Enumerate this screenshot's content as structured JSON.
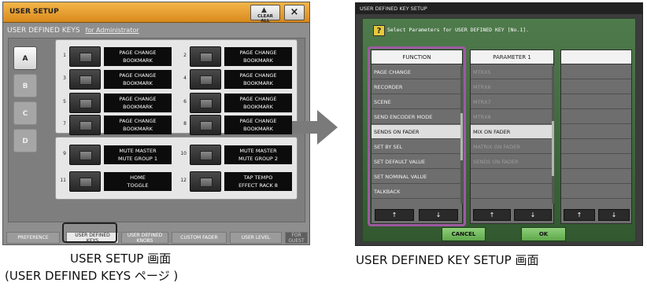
{
  "left_panel": {
    "title": "USER SETUP",
    "clear_all_label": "CLEAR ALL",
    "close_label": "×",
    "subtitle": "USER DEFINED KEYS",
    "subtitle_link": "for Administrator",
    "letter_tabs": [
      "A",
      "B",
      "C",
      "D"
    ],
    "keys": [
      {
        "num": "1",
        "line1": "PAGE CHANGE",
        "line2": "BOOKMARK"
      },
      {
        "num": "2",
        "line1": "PAGE CHANGE",
        "line2": "BOOKMARK"
      },
      {
        "num": "3",
        "line1": "PAGE CHANGE",
        "line2": "BOOKMARK"
      },
      {
        "num": "4",
        "line1": "PAGE CHANGE",
        "line2": "BOOKMARK"
      },
      {
        "num": "5",
        "line1": "PAGE CHANGE",
        "line2": "BOOKMARK"
      },
      {
        "num": "6",
        "line1": "PAGE CHANGE",
        "line2": "BOOKMARK"
      },
      {
        "num": "7",
        "line1": "PAGE CHANGE",
        "line2": "BOOKMARK"
      },
      {
        "num": "8",
        "line1": "PAGE CHANGE",
        "line2": "BOOKMARK"
      },
      {
        "num": "9",
        "line1": "MUTE MASTER",
        "line2": "MUTE GROUP 1"
      },
      {
        "num": "10",
        "line1": "MUTE MASTER",
        "line2": "MUTE GROUP 2"
      },
      {
        "num": "11",
        "line1": "HOME",
        "line2": "TOGGLE"
      },
      {
        "num": "12",
        "line1": "TAP TEMPO",
        "line2": "EFFECT RACK 8"
      }
    ],
    "bottom_tabs": [
      {
        "line1": "PREFERENCE",
        "line2": ""
      },
      {
        "line1": "USER DEFINED",
        "line2": "KEYS"
      },
      {
        "line1": "USER DEFINED",
        "line2": "KNOBS"
      },
      {
        "line1": "CUSTOM FADER",
        "line2": ""
      },
      {
        "line1": "USER LEVEL",
        "line2": ""
      },
      {
        "line1": "FOR",
        "line2": "GUEST"
      }
    ],
    "caption_line1": "USER SETUP 画面",
    "caption_line2": "(USER DEFINED KEYS ページ )"
  },
  "right_panel": {
    "title": "USER DEFINED KEY SETUP",
    "help_icon": "?",
    "subtitle": "Select Parameters for USER DEFINED KEY [No.1].",
    "function_header": "FUNCTION",
    "function_items": [
      "PAGE CHANGE",
      "RECORDER",
      "SCENE",
      "SEND ENCODER MODE",
      "SENDS ON FADER",
      "SET BY SEL",
      "SET DEFAULT VALUE",
      "SET NOMINAL VALUE",
      "TALKBACK"
    ],
    "param1_header": "PARAMETER 1",
    "param1_items": [
      "MTRX5",
      "MTRX6",
      "MTRX7",
      "MTRX8",
      "MIX ON FADER",
      "MATRIX ON FADER",
      "SENDS ON FADER"
    ],
    "param2_header": "",
    "up_arrow": "↑",
    "down_arrow": "↓",
    "cancel_label": "CANCEL",
    "ok_label": "OK",
    "caption": "USER DEFINED KEY SETUP 画面"
  }
}
